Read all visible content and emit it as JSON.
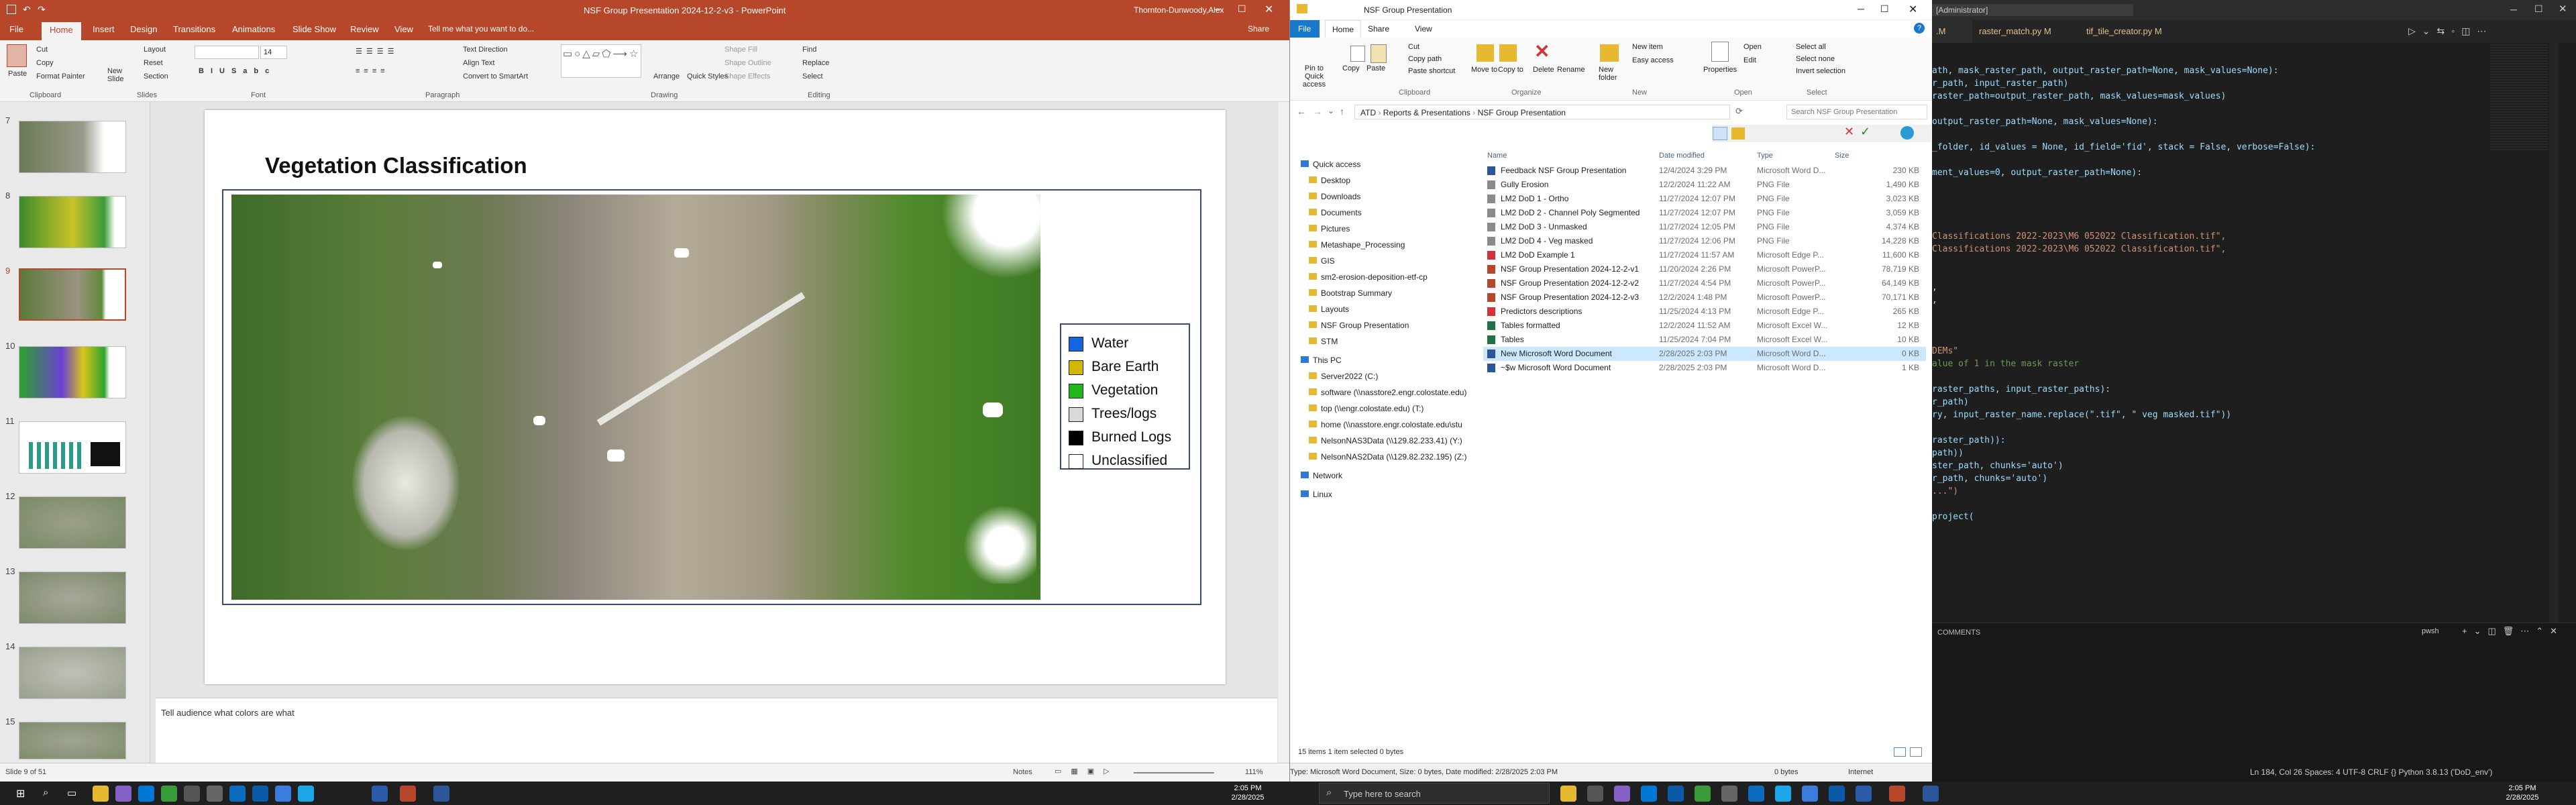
{
  "powerpoint": {
    "title": "NSF Group Presentation 2024-12-2-v3  -  PowerPoint",
    "user": "Thornton-Dunwoody,Alex",
    "share": "Share",
    "tabs": [
      "File",
      "Home",
      "Insert",
      "Design",
      "Transitions",
      "Animations",
      "Slide Show",
      "Review",
      "View"
    ],
    "tell_me": "Tell me what you want to do...",
    "ribbon": {
      "paste": "Paste",
      "cut": "Cut",
      "copy": "Copy",
      "format_painter": "Format Painter",
      "new_slide": "New Slide",
      "layout": "Layout",
      "reset": "Reset",
      "section": "Section",
      "font_size": "14",
      "text_direction": "Text Direction",
      "align_text": "Align Text",
      "convert_smartart": "Convert to SmartArt",
      "arrange": "Arrange",
      "quick_styles": "Quick Styles",
      "shape_fill": "Shape Fill",
      "shape_outline": "Shape Outline",
      "shape_effects": "Shape Effects",
      "find": "Find",
      "replace": "Replace",
      "select": "Select",
      "groups": [
        "Clipboard",
        "Slides",
        "Font",
        "Paragraph",
        "Drawing",
        "Editing"
      ]
    },
    "slide_numbers": [
      "7",
      "8",
      "9",
      "10",
      "11",
      "12",
      "13",
      "14",
      "15"
    ],
    "slide": {
      "title": "Vegetation Classification",
      "legend": [
        {
          "label": "Water",
          "color": "#1565e0"
        },
        {
          "label": "Bare Earth",
          "color": "#d4b800"
        },
        {
          "label": "Vegetation",
          "color": "#1fb81f"
        },
        {
          "label": "Trees/logs",
          "color": "#d9d9d9"
        },
        {
          "label": "Burned Logs",
          "color": "#000000"
        },
        {
          "label": "Unclassified",
          "color": "#ffffff"
        }
      ]
    },
    "notes": "Tell audience what colors are what",
    "status": {
      "slide": "Slide 9 of 51",
      "notes": "Notes",
      "zoom": "111%"
    }
  },
  "explorer": {
    "title": "NSF Group Presentation",
    "tabs": [
      "File",
      "Home",
      "Share",
      "View"
    ],
    "ribbon": {
      "pin": "Pin to Quick access",
      "copy": "Copy",
      "paste": "Paste",
      "cut": "Cut",
      "copy_path": "Copy path",
      "paste_shortcut": "Paste shortcut",
      "move_to": "Move to",
      "copy_to": "Copy to",
      "delete": "Delete",
      "rename": "Rename",
      "new_folder": "New folder",
      "new_item": "New item",
      "easy_access": "Easy access",
      "properties": "Properties",
      "open": "Open",
      "edit": "Edit",
      "select_all": "Select all",
      "select_none": "Select none",
      "invert_selection": "Invert selection",
      "groups": [
        "Clipboard",
        "Organize",
        "New",
        "Open",
        "Select"
      ]
    },
    "breadcrumb": [
      "ATD",
      "Reports & Presentations",
      "NSF Group Presentation"
    ],
    "search_placeholder": "Search NSF Group Presentation",
    "nav": [
      {
        "label": "Quick access",
        "indent": 0
      },
      {
        "label": "Desktop",
        "indent": 1
      },
      {
        "label": "Downloads",
        "indent": 1
      },
      {
        "label": "Documents",
        "indent": 1
      },
      {
        "label": "Pictures",
        "indent": 1
      },
      {
        "label": "Metashape_Processing",
        "indent": 1
      },
      {
        "label": "GIS",
        "indent": 1
      },
      {
        "label": "sm2-erosion-deposition-etf-cp",
        "indent": 1
      },
      {
        "label": "Bootstrap Summary",
        "indent": 1
      },
      {
        "label": "Layouts",
        "indent": 1
      },
      {
        "label": "NSF Group Presentation",
        "indent": 1
      },
      {
        "label": "STM",
        "indent": 1
      },
      {
        "label": "This PC",
        "indent": 0
      },
      {
        "label": "Server2022 (C:)",
        "indent": 1
      },
      {
        "label": "software (\\\\nasstore2.engr.colostate.edu)",
        "indent": 1
      },
      {
        "label": "top (\\\\engr.colostate.edu) (T:)",
        "indent": 1
      },
      {
        "label": "home (\\\\nasstore.engr.colostate.edu\\stu",
        "indent": 1
      },
      {
        "label": "NelsonNAS3Data (\\\\129.82.233.41) (Y:)",
        "indent": 1
      },
      {
        "label": "NelsonNAS2Data (\\\\129.82.232.195) (Z:)",
        "indent": 1
      },
      {
        "label": "Network",
        "indent": 0
      },
      {
        "label": "Linux",
        "indent": 0
      }
    ],
    "columns": [
      "Name",
      "Date modified",
      "Type",
      "Size"
    ],
    "files": [
      {
        "name": "Feedback NSF Group Presentation",
        "date": "12/4/2024 3:29 PM",
        "type": "Microsoft Word D...",
        "size": "230 KB",
        "icon": "#2b579a"
      },
      {
        "name": "Gully Erosion",
        "date": "12/2/2024 11:22 AM",
        "type": "PNG File",
        "size": "1,490 KB",
        "icon": "#8a8a8a"
      },
      {
        "name": "LM2 DoD 1 - Ortho",
        "date": "11/27/2024 12:07 PM",
        "type": "PNG File",
        "size": "3,023 KB",
        "icon": "#8a8a8a"
      },
      {
        "name": "LM2 DoD 2 - Channel Poly Segmented",
        "date": "11/27/2024 12:07 PM",
        "type": "PNG File",
        "size": "3,059 KB",
        "icon": "#8a8a8a"
      },
      {
        "name": "LM2 DoD 3 - Unmasked",
        "date": "11/27/2024 12:05 PM",
        "type": "PNG File",
        "size": "4,374 KB",
        "icon": "#8a8a8a"
      },
      {
        "name": "LM2 DoD 4 - Veg masked",
        "date": "11/27/2024 12:06 PM",
        "type": "PNG File",
        "size": "14,228 KB",
        "icon": "#8a8a8a"
      },
      {
        "name": "LM2 DoD Example 1",
        "date": "11/27/2024 11:57 AM",
        "type": "Microsoft Edge P...",
        "size": "11,600 KB",
        "icon": "#d13438"
      },
      {
        "name": "NSF Group Presentation 2024-12-2-v1",
        "date": "11/20/2024 2:26 PM",
        "type": "Microsoft PowerP...",
        "size": "78,719 KB",
        "icon": "#b7472a"
      },
      {
        "name": "NSF Group Presentation 2024-12-2-v2",
        "date": "11/27/2024 4:54 PM",
        "type": "Microsoft PowerP...",
        "size": "64,149 KB",
        "icon": "#b7472a"
      },
      {
        "name": "NSF Group Presentation 2024-12-2-v3",
        "date": "12/2/2024 1:48 PM",
        "type": "Microsoft PowerP...",
        "size": "70,171 KB",
        "icon": "#b7472a"
      },
      {
        "name": "Predictors descriptions",
        "date": "11/25/2024 4:13 PM",
        "type": "Microsoft Edge P...",
        "size": "265 KB",
        "icon": "#d13438"
      },
      {
        "name": "Tables formatted",
        "date": "12/2/2024 11:52 AM",
        "type": "Microsoft Excel W...",
        "size": "12 KB",
        "icon": "#217346"
      },
      {
        "name": "Tables",
        "date": "11/25/2024 7:04 PM",
        "type": "Microsoft Excel W...",
        "size": "10 KB",
        "icon": "#217346"
      },
      {
        "name": "New Microsoft Word Document",
        "date": "2/28/2025 2:03 PM",
        "type": "Microsoft Word D...",
        "size": "0 KB",
        "icon": "#2b579a"
      },
      {
        "name": "~$w Microsoft Word Document",
        "date": "2/28/2025 2:03 PM",
        "type": "Microsoft Word D...",
        "size": "1 KB",
        "icon": "#2b579a"
      }
    ],
    "status_left": "15 items     1 item selected  0 bytes",
    "details": "Type: Microsoft Word Document, Size: 0 bytes, Date modified: 2/28/2025 2:03 PM",
    "details_size": "0 bytes",
    "details_zone": "Internet"
  },
  "vscode": {
    "title": "[Administrator]",
    "tabs": [
      "raster_match.py M",
      "tif_tile_creator.py M"
    ],
    "code": [
      {
        "t": "ath, mask_raster_path, output_raster_path=None, mask_values=None):",
        "c": "#9cdcfe"
      },
      {
        "t": "r_path, input_raster_path)",
        "c": "#9cdcfe"
      },
      {
        "t": "raster_path=output_raster_path, mask_values=mask_values)",
        "c": "#9cdcfe"
      },
      {
        "t": "",
        "c": "#9cdcfe"
      },
      {
        "t": "output_raster_path=None, mask_values=None):",
        "c": "#9cdcfe"
      },
      {
        "t": "",
        "c": "#9cdcfe"
      },
      {
        "t": "_folder, id_values = None, id_field='fid', stack = False, verbose=False):",
        "c": "#9cdcfe"
      },
      {
        "t": "",
        "c": "#9cdcfe"
      },
      {
        "t": "ment_values=0, output_raster_path=None):",
        "c": "#9cdcfe"
      },
      {
        "t": "",
        "c": "#9cdcfe"
      },
      {
        "t": "",
        "c": "#9cdcfe"
      },
      {
        "t": "",
        "c": "#9cdcfe"
      },
      {
        "t": "",
        "c": "#9cdcfe"
      },
      {
        "t": "Classifications 2022-2023\\M6 052022 Classification.tif\",",
        "c": "#ce9178"
      },
      {
        "t": "Classifications 2022-2023\\M6 052022 Classification.tif\",",
        "c": "#ce9178"
      },
      {
        "t": "",
        "c": "#9cdcfe"
      },
      {
        "t": "",
        "c": "#9cdcfe"
      },
      {
        "t": ",",
        "c": "#d4d4d4"
      },
      {
        "t": ",",
        "c": "#d4d4d4"
      },
      {
        "t": "",
        "c": "#9cdcfe"
      },
      {
        "t": "",
        "c": "#9cdcfe"
      },
      {
        "t": "",
        "c": "#9cdcfe"
      },
      {
        "t": "DEMs\"",
        "c": "#ce9178"
      },
      {
        "t": "alue of 1 in the mask raster",
        "c": "#6a9955"
      },
      {
        "t": "",
        "c": "#9cdcfe"
      },
      {
        "t": "raster_paths, input_raster_paths):",
        "c": "#9cdcfe"
      },
      {
        "t": "r_path)",
        "c": "#9cdcfe"
      },
      {
        "t": "ry, input_raster_name.replace(\".tif\", \" veg masked.tif\"))",
        "c": "#9cdcfe"
      },
      {
        "t": "",
        "c": "#9cdcfe"
      },
      {
        "t": "raster_path)):",
        "c": "#9cdcfe"
      },
      {
        "t": "path))",
        "c": "#9cdcfe"
      },
      {
        "t": "ster_path, chunks='auto')",
        "c": "#9cdcfe"
      },
      {
        "t": "r_path, chunks='auto')",
        "c": "#9cdcfe"
      },
      {
        "t": "...\")",
        "c": "#ce9178"
      },
      {
        "t": "",
        "c": "#9cdcfe"
      },
      {
        "t": "project(",
        "c": "#9cdcfe"
      }
    ],
    "panel_title": "COMMENTS",
    "panel_shell": "pwsh",
    "status": "Ln 184, Col 26   Spaces: 4   UTF-8   CRLF   {} Python   3.8.13 ('DoD_env')"
  },
  "taskbar": {
    "search_placeholder": "Type here to search",
    "time_left": "2:05 PM",
    "date_left": "2/28/2025",
    "time_right": "2:05 PM",
    "date_right": "2/28/2025"
  }
}
